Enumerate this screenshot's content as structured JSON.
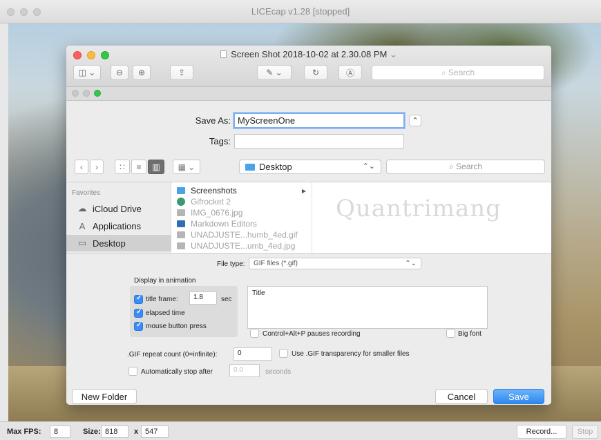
{
  "licecap": {
    "title": "LICEcap v1.28 [stopped]"
  },
  "preview": {
    "title": "Screen Shot 2018-10-02 at 2.30.08 PM",
    "title_chevron": "⌄",
    "search_placeholder": "Search"
  },
  "save": {
    "save_as_label": "Save As:",
    "save_as_value": "MyScreenOne",
    "tags_label": "Tags:",
    "tags_value": "",
    "location": "Desktop",
    "search_placeholder": "Search"
  },
  "sidebar": {
    "header": "Favorites",
    "items": [
      {
        "label": "iCloud Drive",
        "icon": "cloud-icon",
        "glyph": "☁",
        "selected": false
      },
      {
        "label": "Applications",
        "icon": "applications-icon",
        "glyph": "A",
        "selected": false
      },
      {
        "label": "Desktop",
        "icon": "desktop-icon",
        "glyph": "▭",
        "selected": true
      }
    ]
  },
  "files": [
    {
      "name": "Screenshots",
      "kind": "folder",
      "enabled": true,
      "has_arrow": true
    },
    {
      "name": "Gifrocket 2",
      "kind": "app",
      "enabled": false,
      "has_arrow": false
    },
    {
      "name": "IMG_0676.jpg",
      "kind": "image",
      "enabled": false,
      "has_arrow": false
    },
    {
      "name": "Markdown Editors",
      "kind": "doc",
      "enabled": false,
      "has_arrow": false
    },
    {
      "name": "UNADJUSTE...humb_4ed.gif",
      "kind": "image",
      "enabled": false,
      "has_arrow": false
    },
    {
      "name": "UNADJUSTE...umb_4ed.jpg",
      "kind": "image",
      "enabled": false,
      "has_arrow": false
    }
  ],
  "watermark": "Quantrimang",
  "options": {
    "file_type_label": "File type:",
    "file_type_value": "GIF files (*.gif)",
    "display_heading": "Display in animation",
    "title_frame_label": "title frame:",
    "title_frame_value": "1.8",
    "title_frame_unit": "sec",
    "elapsed_time_label": "elapsed time",
    "mouse_press_label": "mouse button press",
    "title_text": "Title",
    "pause_label": "Control+Alt+P pauses recording",
    "big_font_label": "Big font",
    "repeat_label": ".GIF repeat count (0=infinite):",
    "repeat_value": "0",
    "transparency_label": "Use .GIF transparency for smaller files",
    "auto_stop_label": "Automatically stop after",
    "auto_stop_value": "0.0",
    "auto_stop_unit": "seconds",
    "title_frame_checked": true,
    "elapsed_checked": true,
    "mouse_checked": true,
    "pause_checked": false,
    "big_font_checked": false,
    "transparency_checked": false,
    "auto_stop_checked": false
  },
  "buttons": {
    "new_folder": "New Folder",
    "cancel": "Cancel",
    "save": "Save"
  },
  "status": {
    "max_fps_label": "Max FPS:",
    "max_fps_value": "8",
    "size_label": "Size:",
    "width": "818",
    "x_label": "x",
    "height": "547",
    "record": "Record...",
    "stop": "Stop"
  },
  "colors": {
    "accent": "#2f88f0",
    "checkbox_on": "#3b8cf6",
    "folder": "#4aa3e8"
  }
}
